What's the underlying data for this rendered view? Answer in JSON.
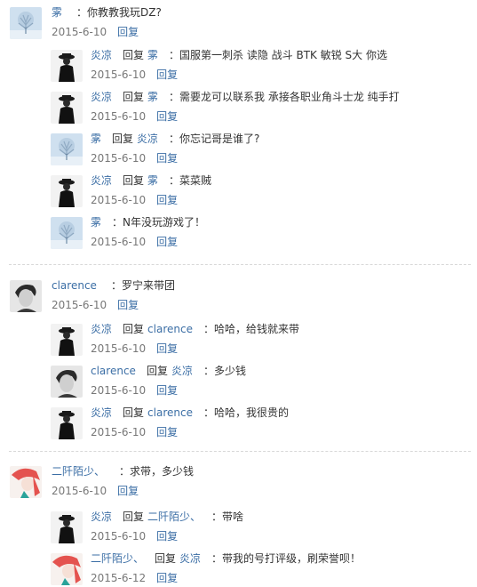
{
  "threads": [
    {
      "main": {
        "user": "雺",
        "text": "：你教教我玩DZ?",
        "date": "2015-6-10",
        "reply": "回复",
        "avatar": "winter-tree"
      },
      "replies": [
        {
          "user": "炎凉",
          "reply_label": "回复",
          "target": "雺",
          "text": "：国服第一刺杀 读隐 战斗 BTK 敏锐 S大 你选",
          "date": "2015-6-10",
          "reply": "回复",
          "avatar": "dark-figure"
        },
        {
          "user": "炎凉",
          "reply_label": "回复",
          "target": "雺",
          "text": "：需要龙可以联系我 承接各职业角斗士龙 纯手打",
          "date": "2015-6-10",
          "reply": "回复",
          "avatar": "dark-figure"
        },
        {
          "user": "雺",
          "reply_label": "回复",
          "target": "炎凉",
          "text": "：你忘记哥是谁了?",
          "date": "2015-6-10",
          "reply": "回复",
          "avatar": "winter-tree"
        },
        {
          "user": "炎凉",
          "reply_label": "回复",
          "target": "雺",
          "text": "：菜菜贼",
          "date": "2015-6-10",
          "reply": "回复",
          "avatar": "dark-figure"
        },
        {
          "user": "雺",
          "reply_label": "",
          "target": "",
          "text": "：N年没玩游戏了！",
          "date": "2015-6-10",
          "reply": "回复",
          "avatar": "winter-tree"
        }
      ]
    },
    {
      "main": {
        "user": "clarence",
        "text": "：罗宁来带团",
        "date": "2015-6-10",
        "reply": "回复",
        "avatar": "portrait"
      },
      "replies": [
        {
          "user": "炎凉",
          "reply_label": "回复",
          "target": "clarence",
          "text": "：哈哈，给钱就来带",
          "date": "2015-6-10",
          "reply": "回复",
          "avatar": "dark-figure"
        },
        {
          "user": "clarence",
          "reply_label": "回复",
          "target": "炎凉",
          "text": "：多少钱",
          "date": "2015-6-10",
          "reply": "回复",
          "avatar": "portrait"
        },
        {
          "user": "炎凉",
          "reply_label": "回复",
          "target": "clarence",
          "text": "：哈哈，我很贵的",
          "date": "2015-6-10",
          "reply": "回复",
          "avatar": "dark-figure"
        }
      ]
    },
    {
      "main": {
        "user": "二阡陌少、",
        "text": "：求带，多少钱",
        "date": "2015-6-10",
        "reply": "回复",
        "avatar": "anime-girl"
      },
      "replies": [
        {
          "user": "炎凉",
          "reply_label": "回复",
          "target": "二阡陌少、",
          "text": "：带啥",
          "date": "2015-6-10",
          "reply": "回复",
          "avatar": "dark-figure"
        },
        {
          "user": "二阡陌少、",
          "reply_label": "回复",
          "target": "炎凉",
          "text": "：带我的号打评级，刷荣誉呗！",
          "date": "2015-6-12",
          "reply": "回复",
          "avatar": "anime-girl"
        }
      ]
    }
  ],
  "colors": {
    "link": "#3b6ea5",
    "text": "#333333",
    "date": "#777777",
    "divider": "#d8d8d8"
  }
}
